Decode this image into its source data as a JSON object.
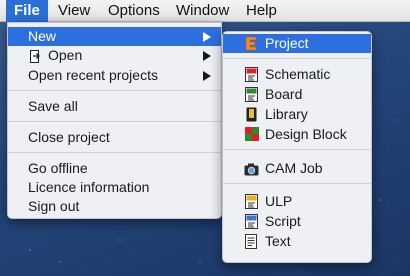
{
  "menubar": {
    "items": [
      "File",
      "View",
      "Options",
      "Window",
      "Help"
    ]
  },
  "file_menu": {
    "items": [
      {
        "label": "New",
        "submenu": true,
        "highlighted": true
      },
      {
        "label": "Open",
        "submenu": true,
        "icon": "open-folder-icon"
      },
      {
        "label": "Open recent projects",
        "submenu": true
      },
      {
        "label": "Save all"
      },
      {
        "label": "Close project"
      },
      {
        "label": "Go offline"
      },
      {
        "label": "Licence information"
      },
      {
        "label": "Sign out"
      }
    ]
  },
  "new_submenu": {
    "items": [
      {
        "label": "Project",
        "icon": "project-e-icon",
        "highlighted": true
      },
      {
        "label": "Schematic",
        "icon": "schematic-icon"
      },
      {
        "label": "Board",
        "icon": "board-icon"
      },
      {
        "label": "Library",
        "icon": "library-book-icon"
      },
      {
        "label": "Design Block",
        "icon": "design-block-icon"
      },
      {
        "label": "CAM Job",
        "icon": "cam-camera-icon"
      },
      {
        "label": "ULP",
        "icon": "ulp-script-icon"
      },
      {
        "label": "Script",
        "icon": "script-icon"
      },
      {
        "label": "Text",
        "icon": "text-document-icon"
      }
    ]
  },
  "colors": {
    "highlight": "#2e6fe0",
    "menubar_active": "#2a6fd6",
    "menu_background": "#eef0f3",
    "desktop_background": "#24467a"
  }
}
